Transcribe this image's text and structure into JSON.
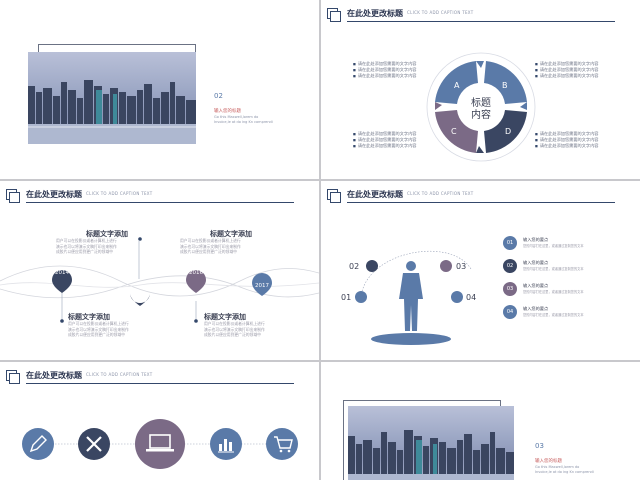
{
  "colors": {
    "navy": "#34486b",
    "blue": "#5a7aa8",
    "plum": "#7b6a86",
    "dark": "#3a4662"
  },
  "slide1": {
    "number": "02",
    "caption": "输入您的标题",
    "caption_sub": "Go this Maxwell,lorem do Invoice,le at do ing Kn comprendi"
  },
  "slide2": {
    "title": "在此处更改标题",
    "subtitle": "CLICK TO ADD CAPTION TEXT",
    "center_text_1": "标题",
    "center_text_2": "内容",
    "segments": [
      "A",
      "B",
      "C",
      "D"
    ],
    "bullet_text": "请在此处添加您需要的文字内容",
    "bullets_tl": [
      "请在此处添加您需要的文字内容",
      "请在此处添加您需要的文字内容",
      "请在此处添加您需要的文字内容"
    ],
    "bullets_tr": [
      "请在此处添加您需要的文字内容",
      "请在此处添加您需要的文字内容",
      "请在此处添加您需要的文字内容"
    ],
    "bullets_bl": [
      "请在此处添加您需要的文字内容",
      "请在此处添加您需要的文字内容",
      "请在此处添加您需要的文字内容"
    ],
    "bullets_br": [
      "请在此处添加您需要的文字内容",
      "请在此处添加您需要的文字内容",
      "请在此处添加您需要的文字内容"
    ]
  },
  "slide3": {
    "title": "在此处更改标题",
    "subtitle": "CLICK TO ADD CAPTION TEXT",
    "years": [
      "2014",
      "2015",
      "2016",
      "2017"
    ],
    "item_title": "标题文字添加",
    "item_body_1": "用户可以在投影仪或者计算机上进行",
    "item_body_2": "演示也可以将演示文稿打印出来制作",
    "item_body_3": "成胶片以便应用到更广泛的领域中"
  },
  "slide4": {
    "title": "在此处更改标题",
    "subtitle": "CLICK TO ADD CAPTION TEXT",
    "labels": [
      "01",
      "02",
      "03",
      "04"
    ],
    "legend": [
      {
        "num": "01",
        "title": "输入您的要点",
        "desc": "您的内容打在这里，或者通过复制您的文本"
      },
      {
        "num": "02",
        "title": "输入您的要点",
        "desc": "您的内容打在这里，或者通过复制您的文本"
      },
      {
        "num": "03",
        "title": "输入您的要点",
        "desc": "您的内容打在这里，或者通过复制您的文本"
      },
      {
        "num": "04",
        "title": "输入您的要点",
        "desc": "您的内容打在这里，或者通过复制您的文本"
      }
    ]
  },
  "slide5": {
    "title": "在此处更改标题",
    "subtitle": "CLICK TO ADD CAPTION TEXT",
    "icons": [
      "pencil-icon",
      "tools-icon",
      "laptop-icon",
      "bar-chart-icon",
      "cart-icon"
    ]
  },
  "slide6": {
    "number": "03",
    "caption": "输入您的标题",
    "caption_sub": "Go this Maxwell,lorem do Invoice,le at do ing Kn comprendi"
  }
}
